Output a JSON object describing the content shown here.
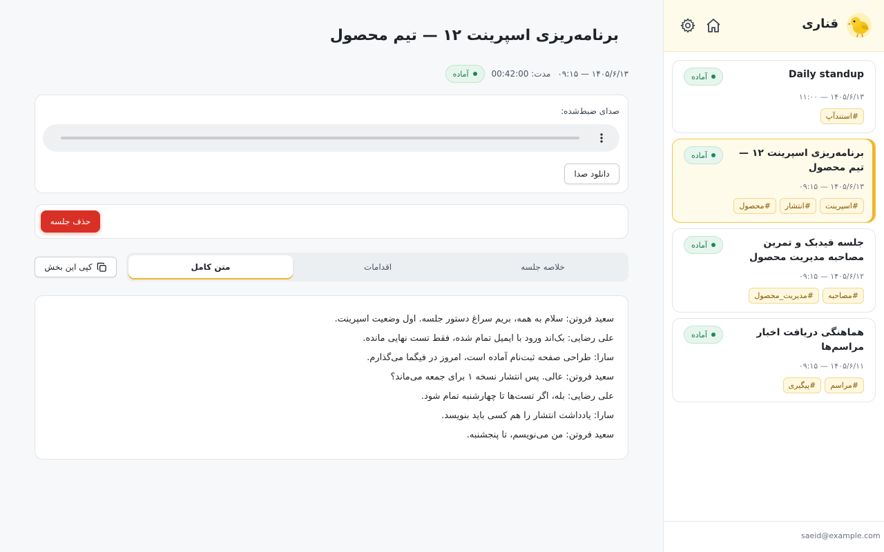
{
  "app": {
    "brand": "قناری",
    "user_email": "saeid@example.com"
  },
  "colors": {
    "accent": "#f0b429",
    "danger": "#d93025",
    "ready_bg": "#e6f6ee",
    "ready_text": "#1f7a4a"
  },
  "meetings": [
    {
      "title": "Daily standup",
      "date": "۱۴۰۵/۶/۱۳ — ۱۱:۰۰",
      "status": "آماده",
      "tags": [
        "#استندآپ"
      ]
    },
    {
      "title": "برنامه‌ریزی اسپرینت ۱۲ — تیم محصول",
      "date": "۱۴۰۵/۶/۱۳ — ۰۹:۱۵",
      "status": "آماده",
      "tags": [
        "#اسپرینت",
        "#انتشار",
        "#محصول"
      ],
      "active": true
    },
    {
      "title": "جلسه فیدبک و تمرین مصاحبه مدیریت محصول",
      "date": "۱۴۰۵/۶/۱۲ — ۰۹:۱۵",
      "status": "آماده",
      "tags": [
        "#مصاحبه",
        "#مدیریت_محصول"
      ]
    },
    {
      "title": "هماهنگی دریافت اخبار مراسم‌ها",
      "date": "۱۴۰۵/۶/۱۱ — ۰۹:۱۵",
      "status": "آماده",
      "tags": [
        "#مراسم",
        "#پیگیری"
      ]
    }
  ],
  "detail": {
    "title": "برنامه‌ریزی اسپرینت ۱۲ — تیم محصول",
    "datetime": "۱۴۰۵/۶/۱۳ — ۰۹:۱۵",
    "duration_label": "مدت: 00:42:00",
    "status": "آماده",
    "audio_label": "صدای ضبط‌شده:",
    "download_label": "دانلود صدا",
    "delete_label": "حذف جلسه",
    "copy_label": "کپی این بخش",
    "tabs": [
      {
        "label": "خلاصه جلسه"
      },
      {
        "label": "اقدامات"
      },
      {
        "label": "متن کامل",
        "active": true
      }
    ],
    "transcript": [
      "سعید فروتن: سلام به همه، بریم سراغ دستور جلسه. اول وضعیت اسپرینت.",
      "علی رضایی: بک‌اند ورود با ایمیل تمام شده، فقط تست نهایی مانده.",
      "سارا: طراحی صفحه ثبت‌نام آماده است، امروز در فیگما می‌گذارم.",
      "سعید فروتن: عالی. پس انتشار نسخه ۱ برای جمعه می‌ماند؟",
      "علی رضایی: بله، اگر تست‌ها تا چهارشنبه تمام شود.",
      "سارا: یادداشت انتشار را هم کسی باید بنویسد.",
      "سعید فروتن: من می‌نویسم، تا پنجشنبه."
    ]
  }
}
